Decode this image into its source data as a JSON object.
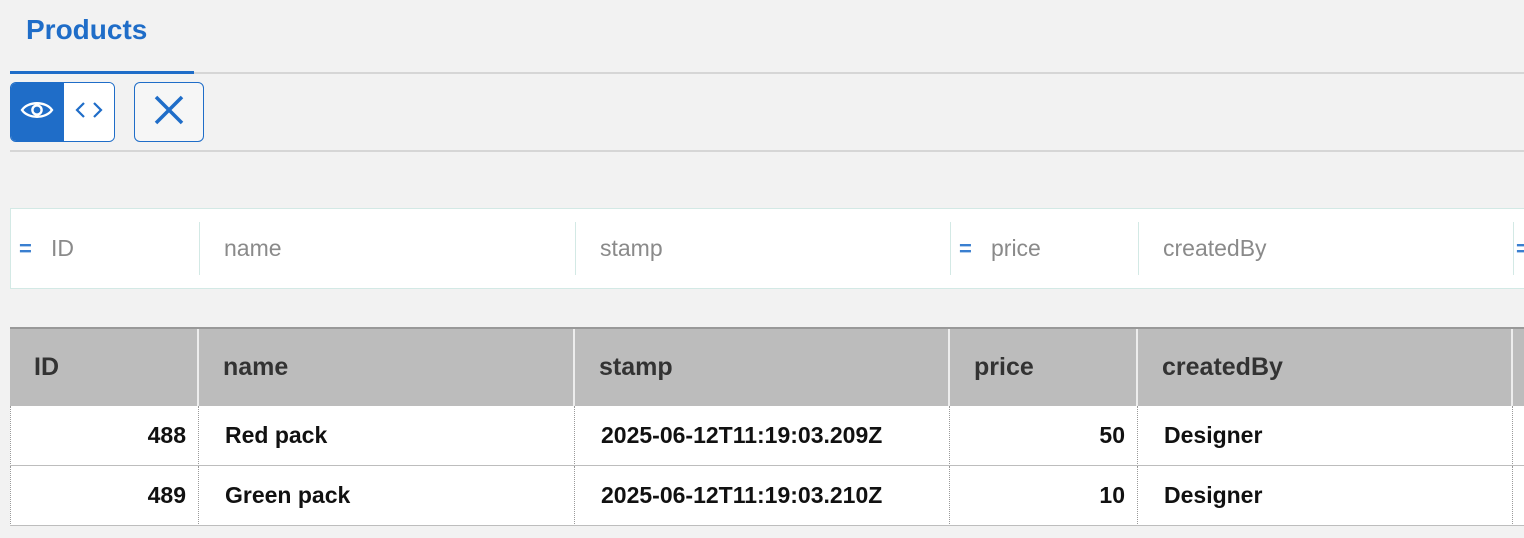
{
  "tabs": [
    {
      "label": "Products",
      "active": true
    }
  ],
  "toolbar": {
    "view_toggle": {
      "active": "view",
      "options": [
        "view-icon",
        "code-icon"
      ]
    },
    "close_icon": "close-icon"
  },
  "filters": [
    {
      "label": "ID",
      "operator": "="
    },
    {
      "label": "name",
      "operator": ""
    },
    {
      "label": "stamp",
      "operator": ""
    },
    {
      "label": "price",
      "operator": "="
    },
    {
      "label": "createdBy",
      "operator": ""
    },
    {
      "label": "",
      "operator": "="
    }
  ],
  "table": {
    "columns": [
      "ID",
      "name",
      "stamp",
      "price",
      "createdBy"
    ],
    "rows": [
      [
        "488",
        "Red pack",
        "2025-06-12T11:19:03.209Z",
        "50",
        "Designer"
      ],
      [
        "489",
        "Green pack",
        "2025-06-12T11:19:03.210Z",
        "10",
        "Designer"
      ]
    ]
  },
  "colors": {
    "accent": "#1f6dc8",
    "header_bg": "#bcbcbc",
    "page_bg": "#f2f2f2"
  }
}
